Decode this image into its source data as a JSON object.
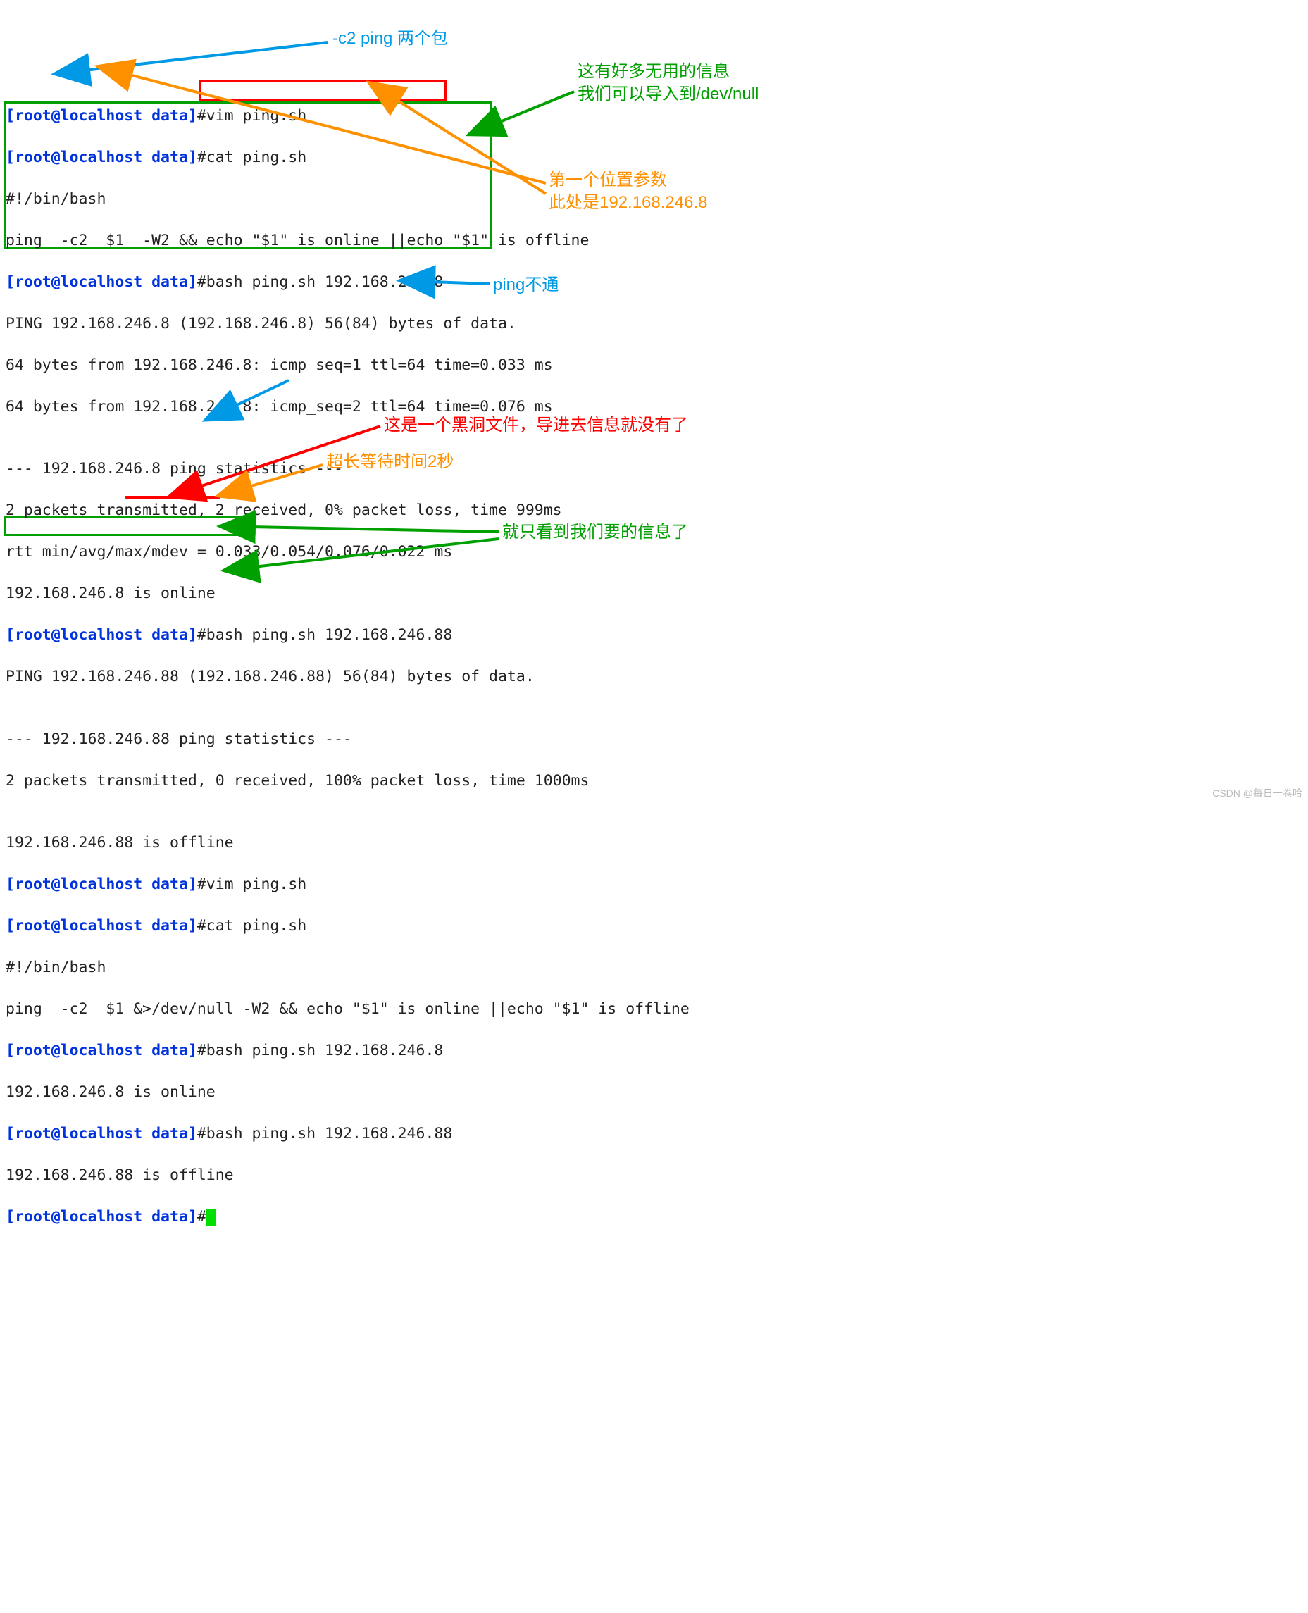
{
  "prompt": "[root@localhost data]",
  "lines": {
    "l1_cmd": "vim ping.sh",
    "l2_cmd": "cat ping.sh",
    "l3": "#!/bin/bash",
    "l4": "ping  -c2  $1  -W2 && echo \"$1\" is online ||echo \"$1\" is offline",
    "l5_cmd": "bash ping.sh 192.168.246.8",
    "l6": "PING 192.168.246.8 (192.168.246.8) 56(84) bytes of data.",
    "l7": "64 bytes from 192.168.246.8: icmp_seq=1 ttl=64 time=0.033 ms",
    "l8": "64 bytes from 192.168.246.8: icmp_seq=2 ttl=64 time=0.076 ms",
    "l9": "",
    "l10": "--- 192.168.246.8 ping statistics ---",
    "l11": "2 packets transmitted, 2 received, 0% packet loss, time 999ms",
    "l12": "rtt min/avg/max/mdev = 0.033/0.054/0.076/0.022 ms",
    "l13": "192.168.246.8 is online",
    "l14_cmd": "bash ping.sh 192.168.246.88",
    "l15": "PING 192.168.246.88 (192.168.246.88) 56(84) bytes of data.",
    "l16": "",
    "l17": "--- 192.168.246.88 ping statistics ---",
    "l18": "2 packets transmitted, 0 received, 100% packet loss, time 1000ms",
    "l19": "",
    "l20": "192.168.246.88 is offline",
    "l21_cmd": "vim ping.sh",
    "l22_cmd": "cat ping.sh",
    "l23": "#!/bin/bash",
    "l24": "ping  -c2  $1 &>/dev/null -W2 && echo \"$1\" is online ||echo \"$1\" is offline",
    "l25_cmd": "bash ping.sh 192.168.246.8",
    "l26": "192.168.246.8 is online",
    "l27_cmd": "bash ping.sh 192.168.246.88",
    "l28": "192.168.246.88 is offline"
  },
  "annotations": {
    "a_blue1": "-c2 ping 两个包",
    "a_green1": "这有好多无用的信息\n我们可以导入到/dev/null",
    "a_orange1": "第一个位置参数\n此处是192.168.246.8",
    "a_blue2": "ping不通",
    "a_red1": "这是一个黑洞文件，导进去信息就没有了",
    "a_orange2": "超长等待时间2秒",
    "a_green2": "就只看到我们要的信息了"
  },
  "watermark": "CSDN @每日一卷哈"
}
